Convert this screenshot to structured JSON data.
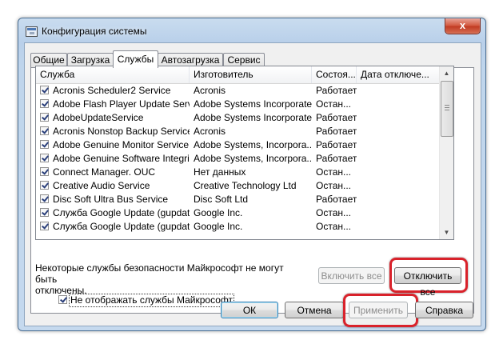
{
  "window": {
    "title": "Конфигурация системы",
    "close_glyph": "x"
  },
  "tabs": [
    {
      "label": "Общие"
    },
    {
      "label": "Загрузка"
    },
    {
      "label": "Службы"
    },
    {
      "label": "Автозагрузка"
    },
    {
      "label": "Сервис"
    }
  ],
  "active_tab": "Службы",
  "table": {
    "columns": [
      "Служба",
      "Изготовитель",
      "Состоя...",
      "Дата отключе..."
    ],
    "rows": [
      {
        "checked": true,
        "service": "Acronis Scheduler2 Service",
        "vendor": "Acronis",
        "status": "Работает"
      },
      {
        "checked": true,
        "service": "Adobe Flash Player Update Service",
        "vendor": "Adobe Systems Incorporated",
        "status": "Остан..."
      },
      {
        "checked": true,
        "service": "AdobeUpdateService",
        "vendor": "Adobe Systems Incorporated",
        "status": "Работает"
      },
      {
        "checked": true,
        "service": "Acronis Nonstop Backup Service",
        "vendor": "Acronis",
        "status": "Работает"
      },
      {
        "checked": true,
        "service": "Adobe Genuine Monitor Service",
        "vendor": "Adobe Systems, Incorpora...",
        "status": "Работает"
      },
      {
        "checked": true,
        "service": "Adobe Genuine Software Integri...",
        "vendor": "Adobe Systems, Incorpora...",
        "status": "Работает"
      },
      {
        "checked": true,
        "service": "Connect Manager. OUC",
        "vendor": "Нет данных",
        "status": "Остан..."
      },
      {
        "checked": true,
        "service": "Creative Audio Service",
        "vendor": "Creative Technology Ltd",
        "status": "Остан..."
      },
      {
        "checked": true,
        "service": "Disc Soft Ultra Bus Service",
        "vendor": "Disc Soft Ltd",
        "status": "Работает"
      },
      {
        "checked": true,
        "service": "Служба Google Update (gupdate)",
        "vendor": "Google Inc.",
        "status": "Остан..."
      },
      {
        "checked": true,
        "service": "Служба Google Update (gupdat...",
        "vendor": "Google Inc.",
        "status": "Остан..."
      }
    ]
  },
  "note": {
    "line1": "Некоторые службы безопасности Майкрософт не могут быть",
    "line2": "отключены."
  },
  "buttons": {
    "enable_all": "Включить все",
    "disable_all": "Отключить все",
    "ok": "ОК",
    "cancel": "Отмена",
    "apply": "Применить",
    "help": "Справка"
  },
  "hide_ms_checkbox": {
    "checked": true,
    "label": "Не отображать службы Майкрософт"
  },
  "colors": {
    "highlight": "#d9222b",
    "titlebar": "#bfd5ec"
  }
}
